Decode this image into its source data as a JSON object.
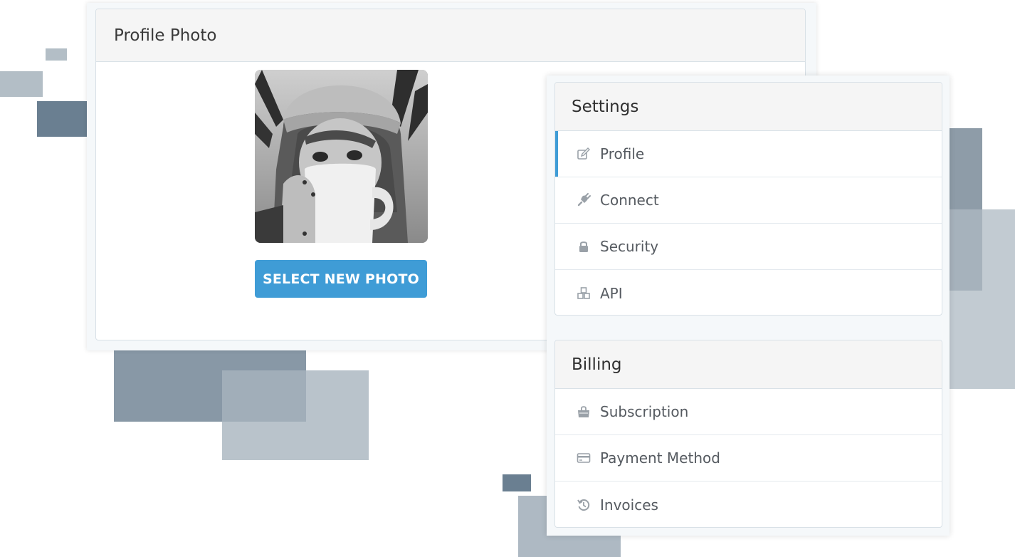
{
  "profile_photo": {
    "title": "Profile Photo",
    "button_label": "SELECT NEW PHOTO"
  },
  "settings": {
    "title": "Settings",
    "items": [
      {
        "label": "Profile",
        "icon": "edit-icon",
        "active": true
      },
      {
        "label": "Connect",
        "icon": "plug-icon",
        "active": false
      },
      {
        "label": "Security",
        "icon": "lock-icon",
        "active": false
      },
      {
        "label": "API",
        "icon": "cubes-icon",
        "active": false
      }
    ]
  },
  "billing": {
    "title": "Billing",
    "items": [
      {
        "label": "Subscription",
        "icon": "shopping-bag-icon"
      },
      {
        "label": "Payment Method",
        "icon": "credit-card-icon"
      },
      {
        "label": "Invoices",
        "icon": "history-icon"
      }
    ]
  },
  "colors": {
    "accent": "#3f9cd6",
    "header_bg": "#f5f5f5",
    "decor_dark": "#6a7f91",
    "decor_light": "#b3bec6"
  }
}
